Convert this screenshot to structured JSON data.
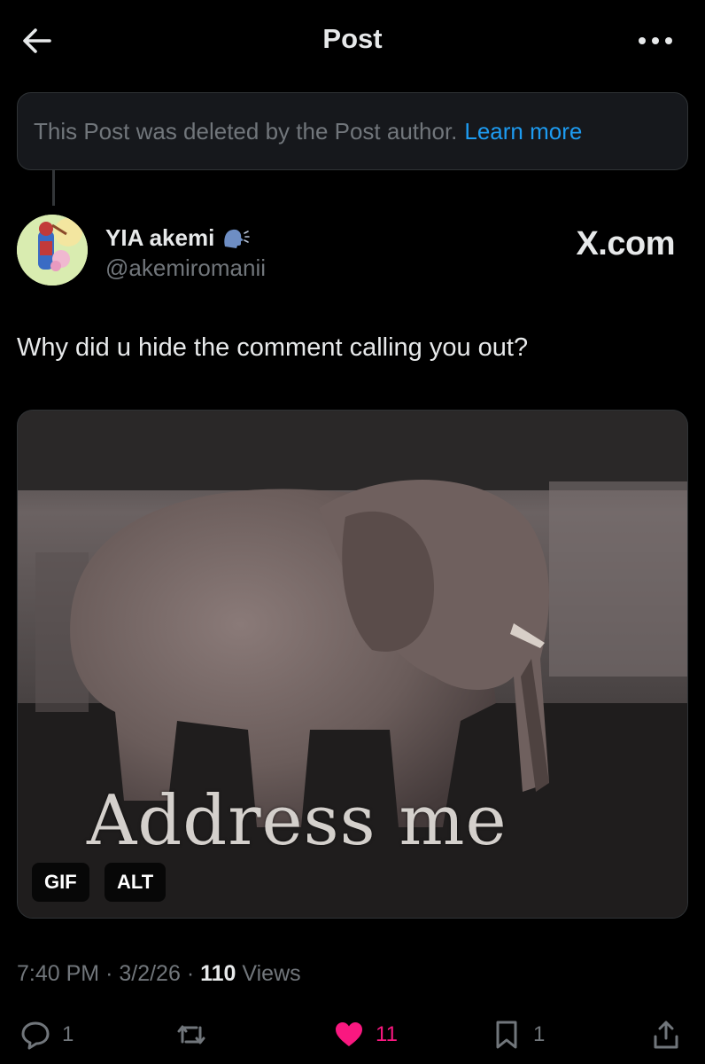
{
  "header": {
    "title": "Post"
  },
  "notice": {
    "text": "This Post was deleted by the Post author.",
    "link": "Learn more"
  },
  "author": {
    "display_name": "YIA akemi",
    "handle": "@akemiromanii",
    "badge_icon": "speaking-head-icon"
  },
  "watermark": "X.com",
  "post": {
    "text": "Why did u hide the comment calling you out?",
    "media": {
      "caption": "Address me",
      "gif_label": "GIF",
      "alt_label": "ALT"
    },
    "time": "7:40 PM",
    "date": "3/2/26",
    "views_count": "110",
    "views_label": "Views"
  },
  "actions": {
    "replies": "1",
    "reposts": "",
    "likes": "11",
    "bookmarks": "1"
  },
  "colors": {
    "background": "#000000",
    "link": "#1d9bf0",
    "like": "#f91880",
    "muted": "#71767b"
  }
}
